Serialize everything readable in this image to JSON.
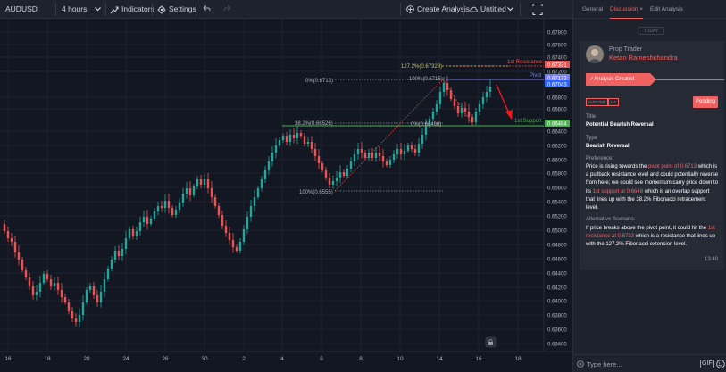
{
  "toolbar": {
    "symbol": "AUDUSD",
    "interval": "4 hours",
    "indicators": "Indicators",
    "settings": "Settings",
    "create_analysis": "Create Analysis",
    "untitled": "Untitled"
  },
  "chart": {
    "price_labels": [
      "0.67800",
      "0.67600",
      "0.67400",
      "0.67321",
      "0.67200",
      "0.67132",
      "0.67043",
      "0.66800",
      "0.66600",
      "0.66484",
      "0.66400",
      "0.66200",
      "0.66000",
      "0.65800",
      "0.65600",
      "0.65400",
      "0.65200",
      "0.65000",
      "0.64800",
      "0.64600",
      "0.64400",
      "0.64200",
      "0.64000",
      "0.63800",
      "0.63600",
      "0.63400"
    ],
    "date_labels": [
      "16",
      "18",
      "20",
      "24",
      "26",
      "30",
      "2",
      "4",
      "6",
      "8",
      "10",
      "14",
      "16",
      "18",
      "22"
    ],
    "annotations": {
      "fib_1272": "127.2%(0.67328)",
      "fib_100_top": "100%(0.6715)",
      "fib_0_top": "0%(0.6713)",
      "fib_382": "38.2%(0.66526)",
      "fib_0_mid": "0%(0.66498)",
      "fib_100_low": "100%(0.6555)",
      "resistance": "1st Resistance",
      "pivot": "Pivot",
      "support": "1st Support"
    },
    "colors": {
      "up": "#26a69a",
      "down": "#ef5350",
      "resistance": "#ef5350",
      "pivot": "#7b7ff7",
      "support": "#4caf50",
      "fib": "#c8c870"
    }
  },
  "panel": {
    "tabs": [
      "General",
      "Discussion",
      "Edit Analysis"
    ],
    "tab_close": "×",
    "today": "TODAY",
    "role": "Prop Trader",
    "user": "Ketan Rameshchandra",
    "status_banner": "Analysis Created",
    "tags": [
      "AUDUSD",
      "H4"
    ],
    "status": "Pending",
    "title_label": "Title",
    "title_value": "Potential Bearish Reversal",
    "type_label": "Type",
    "type_value": "Bearish Reversal",
    "pref_label": "Preference:",
    "pref_1": "Price is rising towards the ",
    "pref_hl1": "pivot point of 0.6713",
    "pref_2": " which is a pullback resistance level and could potentially reverse from here; we could see momentum carry price down to its ",
    "pref_hl2": "1st support at 0.6648",
    "pref_3": " which is an overlap support that lines up with the 38.2% Fibonacci retracement level.",
    "alt_label": "Alternative Scenario:",
    "alt_1": "If price breaks above the pivot point, it could hit the ",
    "alt_hl": "1st resistance at 0.6733",
    "alt_2": " which is a resistance that lines up with the 127.2% Fibonacci extension level.",
    "time": "13:40",
    "input_placeholder": "Type here...",
    "gif": "GIF"
  }
}
